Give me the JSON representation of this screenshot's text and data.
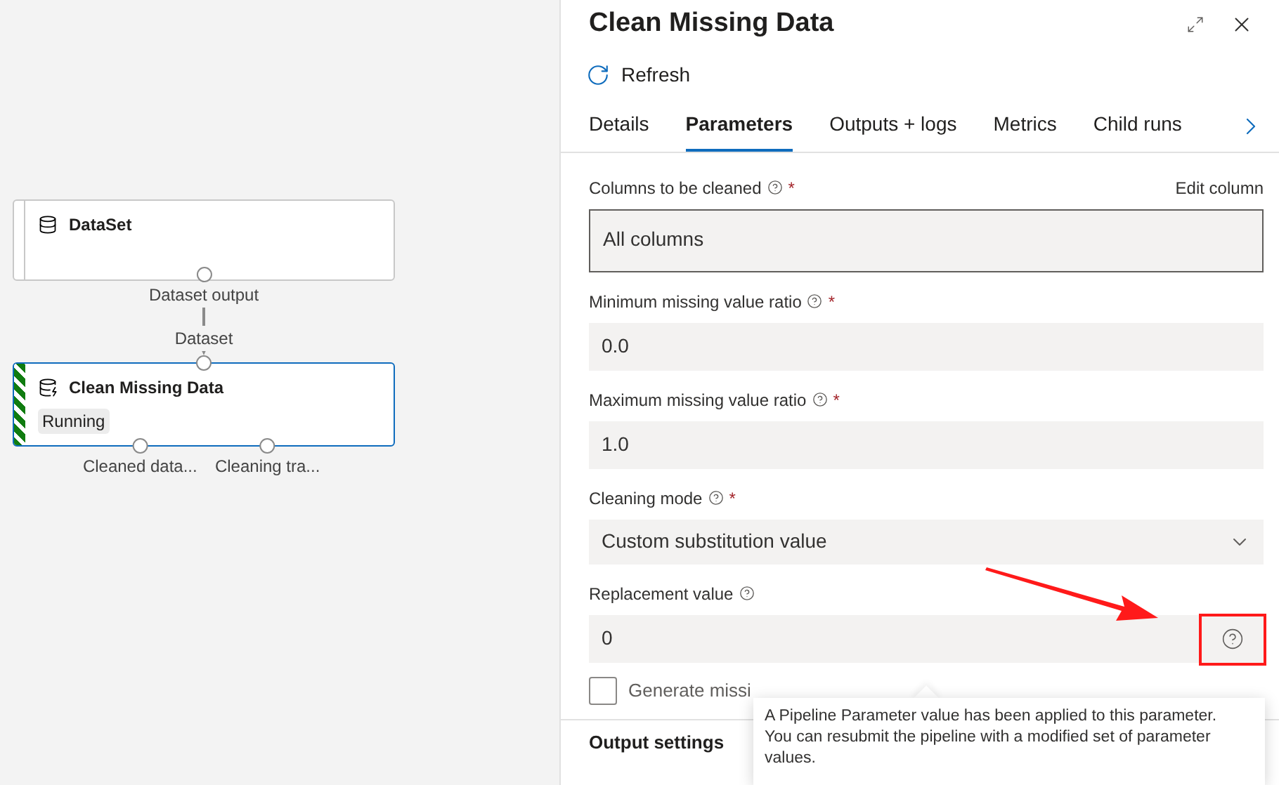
{
  "canvas": {
    "nodes": [
      {
        "title": "DataSet",
        "kind": "dataset",
        "running": false,
        "output_ports": [
          {
            "label": "Dataset output"
          }
        ]
      },
      {
        "title": "Clean Missing Data",
        "kind": "module",
        "running": true,
        "status": "Running",
        "input_ports": [
          {
            "label": "Dataset"
          }
        ],
        "output_ports": [
          {
            "label": "Cleaned data..."
          },
          {
            "label": "Cleaning tra..."
          }
        ]
      }
    ]
  },
  "panel": {
    "title": "Clean Missing Data",
    "refresh": "Refresh",
    "tabs": [
      {
        "label": "Details",
        "selected": false
      },
      {
        "label": "Parameters",
        "selected": true
      },
      {
        "label": "Outputs + logs",
        "selected": false
      },
      {
        "label": "Metrics",
        "selected": false
      },
      {
        "label": "Child runs",
        "selected": false
      }
    ],
    "parameters": [
      {
        "label": "Columns to be cleaned",
        "required_mark": "*",
        "kind": "columns",
        "value": "All columns",
        "link": "Edit column"
      },
      {
        "label": "Minimum missing value ratio",
        "required_mark": "*",
        "kind": "text",
        "value": "0.0"
      },
      {
        "label": "Maximum missing value ratio",
        "required_mark": "*",
        "kind": "text",
        "value": "1.0"
      },
      {
        "label": "Cleaning mode",
        "required_mark": "*",
        "kind": "dropdown",
        "value": "Custom substitution value"
      },
      {
        "label": "Replacement value",
        "kind": "text",
        "value": "0",
        "highlighted": true
      }
    ],
    "checkbox": {
      "label": "Generate missi",
      "checked": false
    },
    "tooltip": "A Pipeline Parameter value has been applied to this parameter. You can resubmit the pipeline with a modified set of parameter values.",
    "section": "Output settings"
  }
}
